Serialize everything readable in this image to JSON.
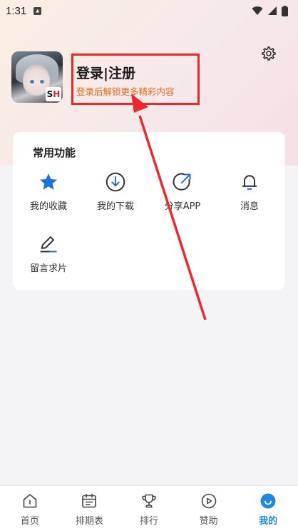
{
  "status_bar": {
    "time": "1:31"
  },
  "profile": {
    "login_title": "登录|注册",
    "login_subtitle": "登录后解锁更多精彩内容",
    "avatar_badge_s": "S",
    "avatar_badge_h": "H"
  },
  "features": {
    "title": "常用功能",
    "items": [
      {
        "label": "我的收藏",
        "icon": "star-icon"
      },
      {
        "label": "我的下载",
        "icon": "download-icon"
      },
      {
        "label": "分享APP",
        "icon": "share-icon"
      },
      {
        "label": "消息",
        "icon": "bell-icon"
      },
      {
        "label": "留言求片",
        "icon": "edit-icon"
      }
    ]
  },
  "tabbar": {
    "items": [
      {
        "label": "首页",
        "icon": "home-icon"
      },
      {
        "label": "排期表",
        "icon": "calendar-icon"
      },
      {
        "label": "排行",
        "icon": "trophy-icon"
      },
      {
        "label": "赞助",
        "icon": "play-circle-icon"
      },
      {
        "label": "我的",
        "icon": "profile-smile-icon",
        "active": true
      }
    ]
  },
  "colors": {
    "accent": "#1e88e5",
    "highlight_box": "#f0262b",
    "subtitle": "#e7691e",
    "arrow": "#f0262b"
  }
}
